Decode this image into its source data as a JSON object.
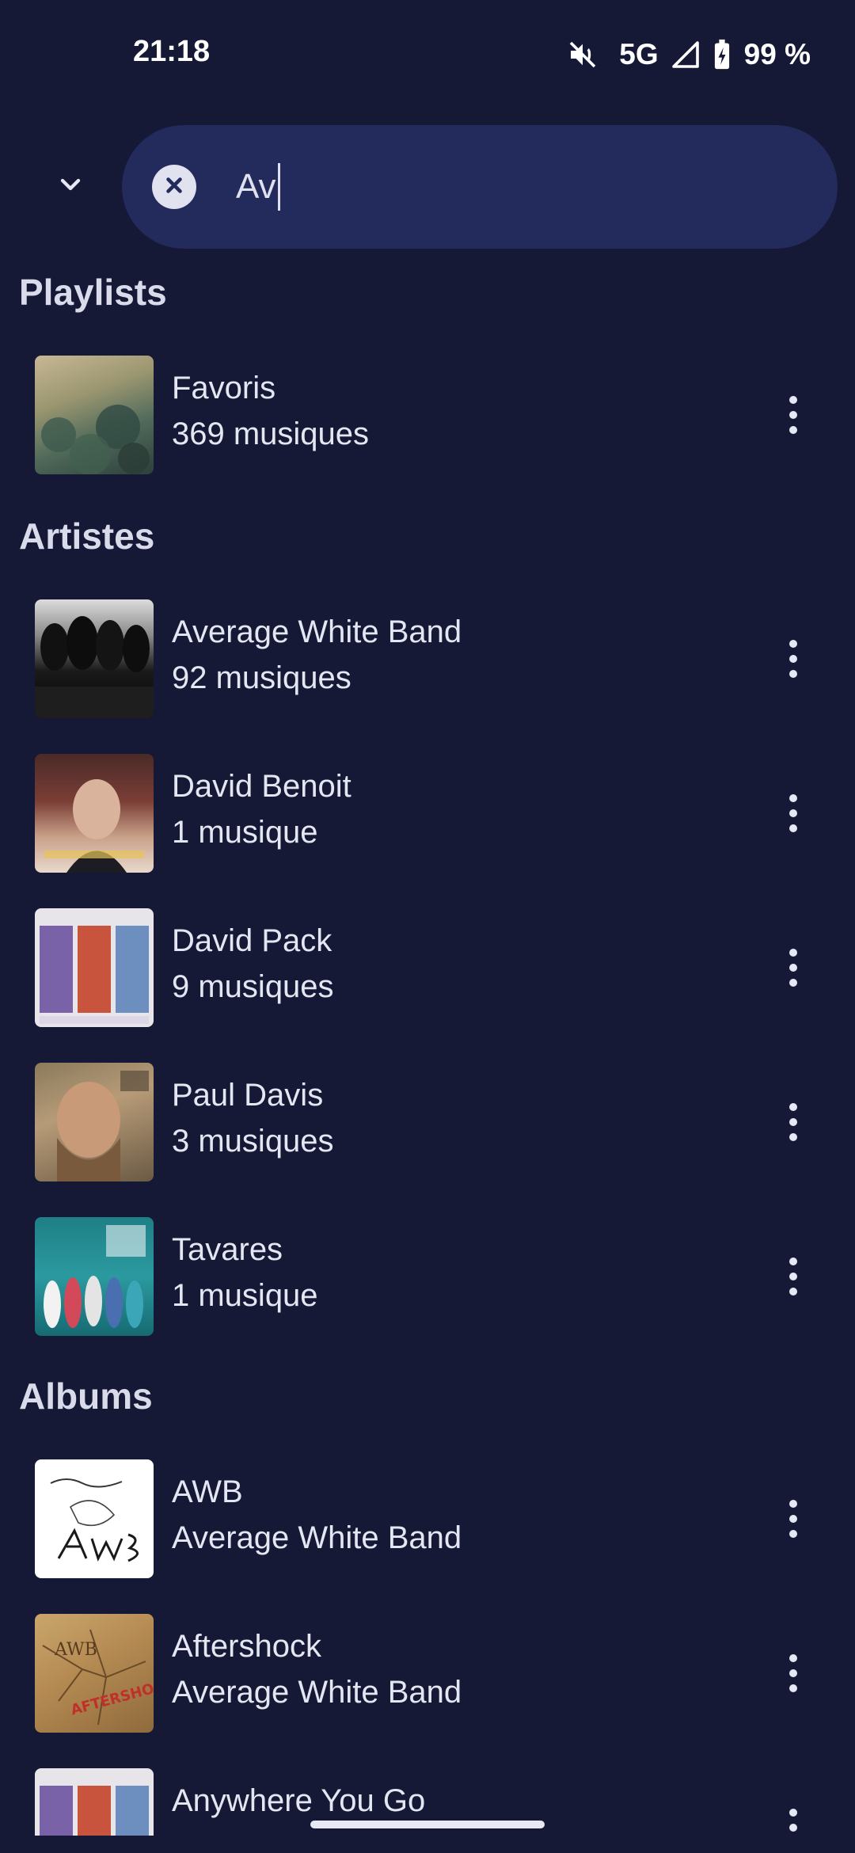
{
  "status": {
    "time": "21:18",
    "network": "5G",
    "battery": "99 %",
    "icons": [
      "mute-icon",
      "signal-icon",
      "battery-charging-icon"
    ]
  },
  "search": {
    "query": "Av",
    "back_icon": "chevron-down-icon",
    "clear_icon": "clear-icon"
  },
  "sections": {
    "playlists": "Playlists",
    "artists": "Artistes",
    "albums": "Albums"
  },
  "playlists": [
    {
      "title": "Favoris",
      "subtitle": "369 musiques"
    }
  ],
  "artists": [
    {
      "title": "Average White Band",
      "subtitle": "92 musiques"
    },
    {
      "title": "David Benoit",
      "subtitle": "1 musique"
    },
    {
      "title": "David Pack",
      "subtitle": "9 musiques"
    },
    {
      "title": "Paul Davis",
      "subtitle": "3 musiques"
    },
    {
      "title": "Tavares",
      "subtitle": "1 musique"
    }
  ],
  "albums": [
    {
      "title": "AWB",
      "subtitle": "Average White Band"
    },
    {
      "title": "Aftershock",
      "subtitle": "Average White Band"
    },
    {
      "title": "Anywhere You Go",
      "subtitle": ""
    }
  ],
  "colors": {
    "background": "#151936",
    "search_bar": "#232a5c",
    "text": "#e4e6f2"
  }
}
